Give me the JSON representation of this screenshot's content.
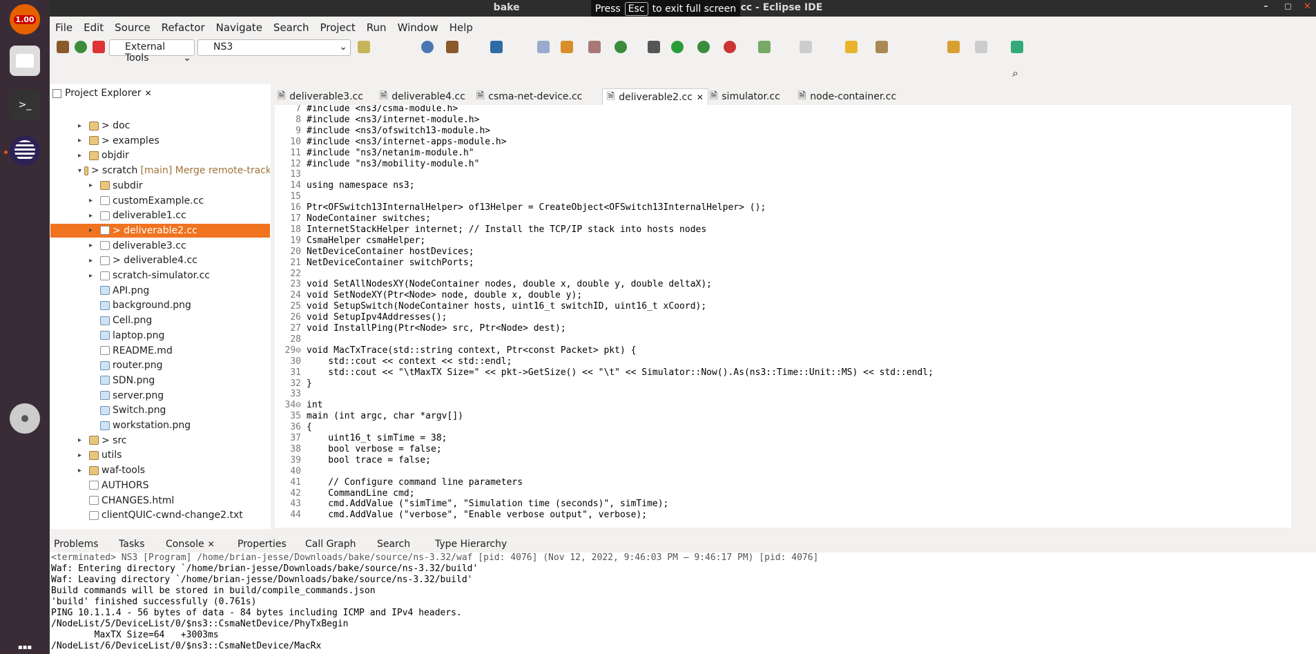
{
  "window": {
    "title_left": "bake",
    "title_right": "cc - Eclipse IDE",
    "fullscreen_press": "Press",
    "fullscreen_key": "Esc",
    "fullscreen_msg": "to exit full screen"
  },
  "dock": {
    "badge": "1.00"
  },
  "menu": [
    "File",
    "Edit",
    "Source",
    "Refactor",
    "Navigate",
    "Search",
    "Project",
    "Run",
    "Window",
    "Help"
  ],
  "toolbar": {
    "external_tools": "External Tools",
    "launch_config": "NS3"
  },
  "project_explorer": {
    "title": "Project Explorer",
    "items": [
      {
        "label": "> doc",
        "indent": 0,
        "kind": "folder",
        "arrow": "▸"
      },
      {
        "label": "> examples",
        "indent": 0,
        "kind": "folder",
        "arrow": "▸"
      },
      {
        "label": "objdir",
        "indent": 0,
        "kind": "folder",
        "arrow": "▸"
      },
      {
        "label": "> scratch",
        "extra": "[main] Merge remote-track",
        "indent": 0,
        "kind": "folder",
        "arrow": "▾"
      },
      {
        "label": "subdir",
        "indent": 1,
        "kind": "folder",
        "arrow": "▸"
      },
      {
        "label": "customExample.cc",
        "indent": 1,
        "kind": "file",
        "arrow": "▸"
      },
      {
        "label": "deliverable1.cc",
        "indent": 1,
        "kind": "file",
        "arrow": "▸"
      },
      {
        "label": "> deliverable2.cc",
        "indent": 1,
        "kind": "file",
        "arrow": "▸",
        "selected": true
      },
      {
        "label": "deliverable3.cc",
        "indent": 1,
        "kind": "file",
        "arrow": "▸"
      },
      {
        "label": "> deliverable4.cc",
        "indent": 1,
        "kind": "file",
        "arrow": "▸"
      },
      {
        "label": "scratch-simulator.cc",
        "indent": 1,
        "kind": "file",
        "arrow": "▸"
      },
      {
        "label": "API.png",
        "indent": 1,
        "kind": "img",
        "arrow": ""
      },
      {
        "label": "background.png",
        "indent": 1,
        "kind": "img",
        "arrow": ""
      },
      {
        "label": "Cell.png",
        "indent": 1,
        "kind": "img",
        "arrow": ""
      },
      {
        "label": "laptop.png",
        "indent": 1,
        "kind": "img",
        "arrow": ""
      },
      {
        "label": "README.md",
        "indent": 1,
        "kind": "file",
        "arrow": ""
      },
      {
        "label": "router.png",
        "indent": 1,
        "kind": "img",
        "arrow": ""
      },
      {
        "label": "SDN.png",
        "indent": 1,
        "kind": "img",
        "arrow": ""
      },
      {
        "label": "server.png",
        "indent": 1,
        "kind": "img",
        "arrow": ""
      },
      {
        "label": "Switch.png",
        "indent": 1,
        "kind": "img",
        "arrow": ""
      },
      {
        "label": "workstation.png",
        "indent": 1,
        "kind": "img",
        "arrow": ""
      },
      {
        "label": "> src",
        "indent": 0,
        "kind": "folder",
        "arrow": "▸"
      },
      {
        "label": "utils",
        "indent": 0,
        "kind": "folder",
        "arrow": "▸"
      },
      {
        "label": "waf-tools",
        "indent": 0,
        "kind": "folder",
        "arrow": "▸"
      },
      {
        "label": "AUTHORS",
        "indent": 0,
        "kind": "file",
        "arrow": ""
      },
      {
        "label": "CHANGES.html",
        "indent": 0,
        "kind": "file",
        "arrow": ""
      },
      {
        "label": "clientQUIC-cwnd-change2.txt",
        "indent": 0,
        "kind": "file",
        "arrow": ""
      }
    ]
  },
  "editor_tabs": [
    "deliverable3.cc",
    "deliverable4.cc",
    "csma-net-device.cc",
    "deliverable2.cc",
    "simulator.cc",
    "node-container.cc"
  ],
  "code": [
    {
      "n": "7",
      "t": "#include <ns3/csma-module.h>"
    },
    {
      "n": "8",
      "t": "#include <ns3/internet-module.h>"
    },
    {
      "n": "9",
      "t": "#include <ns3/ofswitch13-module.h>"
    },
    {
      "n": "10",
      "t": "#include <ns3/internet-apps-module.h>"
    },
    {
      "n": "11",
      "t": "#include \"ns3/netanim-module.h\""
    },
    {
      "n": "12",
      "t": "#include \"ns3/mobility-module.h\""
    },
    {
      "n": "13",
      "t": ""
    },
    {
      "n": "14",
      "t": "using namespace ns3;"
    },
    {
      "n": "15",
      "t": ""
    },
    {
      "n": "16",
      "t": "Ptr<OFSwitch13InternalHelper> of13Helper = CreateObject<OFSwitch13InternalHelper> ();"
    },
    {
      "n": "17",
      "t": "NodeContainer switches;"
    },
    {
      "n": "18",
      "t": "InternetStackHelper internet; // Install the TCP/IP stack into hosts nodes"
    },
    {
      "n": "19",
      "t": "CsmaHelper csmaHelper;"
    },
    {
      "n": "20",
      "t": "NetDeviceContainer hostDevices;"
    },
    {
      "n": "21",
      "t": "NetDeviceContainer switchPorts;"
    },
    {
      "n": "22",
      "t": ""
    },
    {
      "n": "23",
      "t": "void SetAllNodesXY(NodeContainer nodes, double x, double y, double deltaX);"
    },
    {
      "n": "24",
      "t": "void SetNodeXY(Ptr<Node> node, double x, double y);"
    },
    {
      "n": "25",
      "t": "void SetupSwitch(NodeContainer hosts, uint16_t switchID, uint16_t xCoord);"
    },
    {
      "n": "26",
      "t": "void SetupIpv4Addresses();"
    },
    {
      "n": "27",
      "t": "void InstallPing(Ptr<Node> src, Ptr<Node> dest);"
    },
    {
      "n": "28",
      "t": ""
    },
    {
      "n": "29⊖",
      "t": "void MacTxTrace(std::string context, Ptr<const Packet> pkt) {"
    },
    {
      "n": "30",
      "t": "    std::cout << context << std::endl;"
    },
    {
      "n": "31",
      "t": "    std::cout << \"\\tMaxTX Size=\" << pkt->GetSize() << \"\\t\" << Simulator::Now().As(ns3::Time::Unit::MS) << std::endl;"
    },
    {
      "n": "32",
      "t": "}"
    },
    {
      "n": "33",
      "t": ""
    },
    {
      "n": "34⊖",
      "t": "int"
    },
    {
      "n": "35",
      "t": "main (int argc, char *argv[])"
    },
    {
      "n": "36",
      "t": "{"
    },
    {
      "n": "37",
      "t": "    uint16_t simTime = 38;"
    },
    {
      "n": "38",
      "t": "    bool verbose = false;"
    },
    {
      "n": "39",
      "t": "    bool trace = false;"
    },
    {
      "n": "40",
      "t": ""
    },
    {
      "n": "41",
      "t": "    // Configure command line parameters"
    },
    {
      "n": "42",
      "t": "    CommandLine cmd;"
    },
    {
      "n": "43",
      "t": "    cmd.AddValue (\"simTime\", \"Simulation time (seconds)\", simTime);"
    },
    {
      "n": "44",
      "t": "    cmd.AddValue (\"verbose\", \"Enable verbose output\", verbose);"
    }
  ],
  "bottom_tabs": [
    "Problems",
    "Tasks",
    "Console",
    "Properties",
    "Call Graph",
    "Search",
    "Type Hierarchy"
  ],
  "console": [
    "<terminated> NS3 [Program] /home/brian-jesse/Downloads/bake/source/ns-3.32/waf [pid: 4076] (Nov 12, 2022, 9:46:03 PM – 9:46:17 PM) [pid: 4076]",
    "Waf: Entering directory `/home/brian-jesse/Downloads/bake/source/ns-3.32/build'",
    "Waf: Leaving directory `/home/brian-jesse/Downloads/bake/source/ns-3.32/build'",
    "Build commands will be stored in build/compile_commands.json",
    "'build' finished successfully (0.761s)",
    "PING 10.1.1.4 - 56 bytes of data - 84 bytes including ICMP and IPv4 headers.",
    "/NodeList/5/DeviceList/0/$ns3::CsmaNetDevice/PhyTxBegin",
    "        MaxTX Size=64   +3003ms",
    "/NodeList/6/DeviceList/0/$ns3::CsmaNetDevice/MacRx"
  ]
}
